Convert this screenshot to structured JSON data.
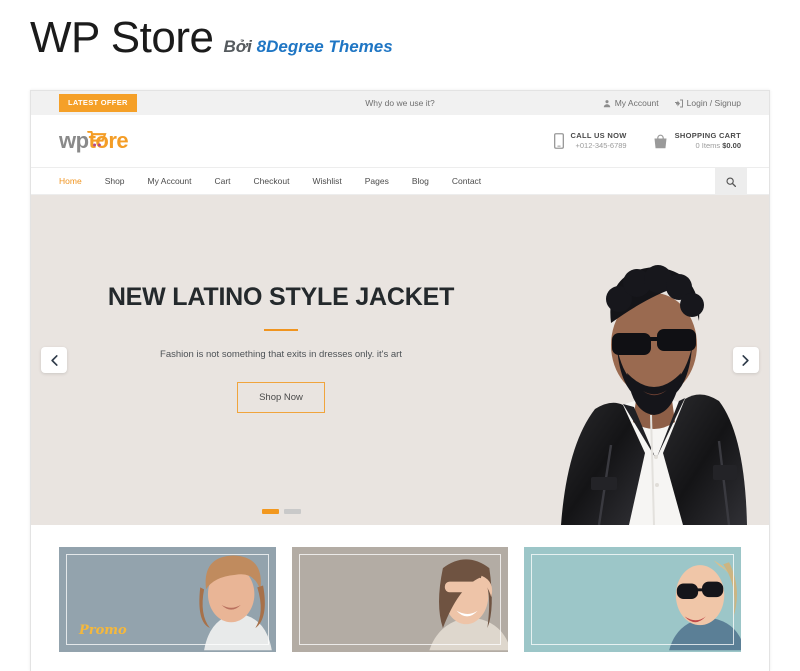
{
  "page": {
    "title": "WP Store",
    "by_word": "Bởi",
    "author": "8Degree Themes"
  },
  "topbar": {
    "offer_badge": "LATEST OFFER",
    "center_text": "Why do we use it?",
    "links": [
      {
        "label": "My Account",
        "icon": "user-icon"
      },
      {
        "label": "Login / Signup",
        "icon": "login-icon"
      }
    ]
  },
  "header": {
    "logo": {
      "part1": "wp",
      "part2": "tore",
      "icon": "shopping-cart-icon"
    },
    "call": {
      "title": "CALL US NOW",
      "number": "+012-345-6789",
      "icon": "mobile-phone-icon"
    },
    "cart": {
      "title": "SHOPPING CART",
      "items_text": "0 Items",
      "amount": "$0.00",
      "icon": "shopping-bag-icon"
    }
  },
  "nav": {
    "items": [
      {
        "label": "Home",
        "active": true
      },
      {
        "label": "Shop",
        "active": false
      },
      {
        "label": "My Account",
        "active": false
      },
      {
        "label": "Cart",
        "active": false
      },
      {
        "label": "Checkout",
        "active": false
      },
      {
        "label": "Wishlist",
        "active": false
      },
      {
        "label": "Pages",
        "active": false
      },
      {
        "label": "Blog",
        "active": false
      },
      {
        "label": "Contact",
        "active": false
      }
    ],
    "search_icon": "search-icon"
  },
  "hero": {
    "title": "NEW LATINO STYLE JACKET",
    "subtitle": "Fashion is not something that exits in  dresses only. it's art",
    "button": "Shop Now",
    "prev_icon": "chevron-left-icon",
    "next_icon": "chevron-right-icon",
    "slides": [
      {
        "active": true
      },
      {
        "active": false
      }
    ]
  },
  "promos": [
    {
      "label": "Promo",
      "bg": "#93a3ad"
    },
    {
      "label": "",
      "bg": "#b3aca4"
    },
    {
      "label": "",
      "bg": "#9cc6c8"
    }
  ],
  "colors": {
    "accent": "#f0941f",
    "badge": "#f5a028",
    "brand_link": "#1f76c4",
    "hero_bg": "#e9e4e0",
    "topbar_bg": "#f1f1f1"
  }
}
